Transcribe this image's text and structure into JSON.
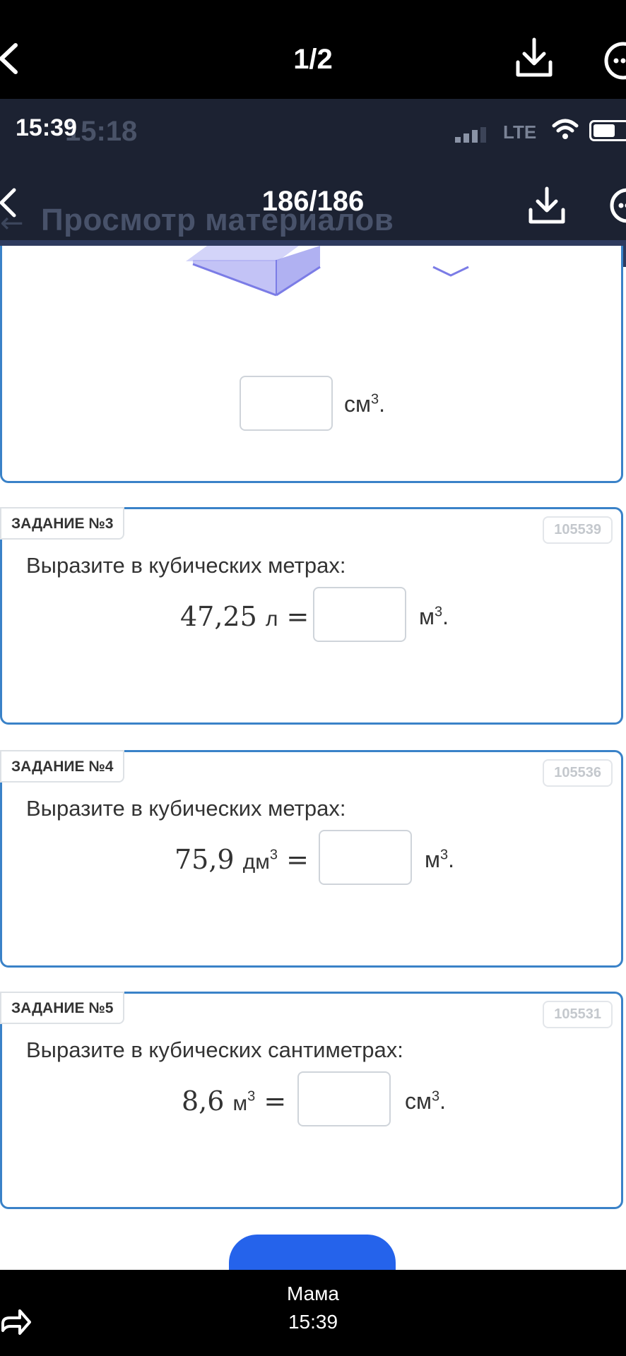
{
  "viewer": {
    "counter": "1/2",
    "sender": "Мама",
    "sent_time": "15:39"
  },
  "inner_screen": {
    "status_time": "15:39",
    "ghost_time": "15:18",
    "network": "LTE",
    "counter": "186/186",
    "ghost_title": "Просмотр материалов"
  },
  "top_card": {
    "unit": "см",
    "unit_exp": "3",
    "unit_dot": "."
  },
  "tasks": [
    {
      "badge": "ЗАДАНИЕ №3",
      "id": "105539",
      "question": "Выразите в кубических метрах:",
      "expr_num": "47,25",
      "expr_unit": "л",
      "expr_exp": "",
      "equals": "=",
      "answer_unit": "м",
      "answer_exp": "3",
      "answer_dot": "."
    },
    {
      "badge": "ЗАДАНИЕ №4",
      "id": "105536",
      "question": "Выразите в кубических метрах:",
      "expr_num": "75,9",
      "expr_unit": "дм",
      "expr_exp": "3",
      "equals": "=",
      "answer_unit": "м",
      "answer_exp": "3",
      "answer_dot": "."
    },
    {
      "badge": "ЗАДАНИЕ №5",
      "id": "105531",
      "question": "Выразите в кубических сантиметрах:",
      "expr_num": "8,6",
      "expr_unit": "м",
      "expr_exp": "3",
      "equals": "=",
      "answer_unit": "см",
      "answer_exp": "3",
      "answer_dot": "."
    }
  ],
  "colors": {
    "card_border": "#3a82c8",
    "header_bg": "#1c2232",
    "button_blue": "#2563eb"
  }
}
